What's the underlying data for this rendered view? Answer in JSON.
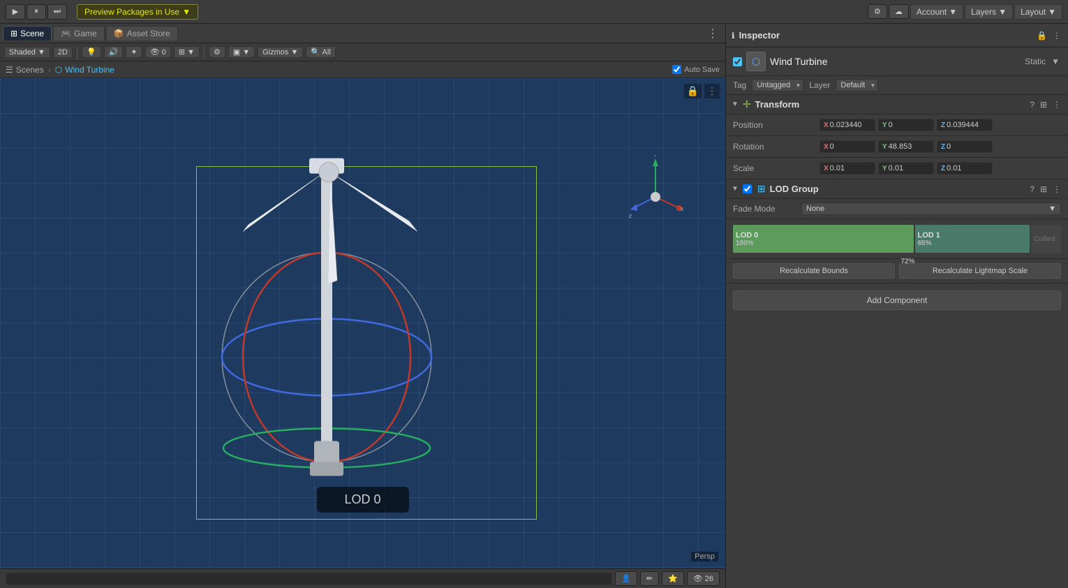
{
  "topbar": {
    "preview_btn": "Preview Packages in Use",
    "account_label": "Account",
    "layers_label": "Layers",
    "layout_label": "Layout"
  },
  "scene_tabs": [
    {
      "id": "scene",
      "label": "Scene",
      "icon": "⊞",
      "active": true
    },
    {
      "id": "game",
      "label": "Game",
      "icon": "🎮",
      "active": false
    },
    {
      "id": "asset_store",
      "label": "Asset Store",
      "icon": "📦",
      "active": false
    }
  ],
  "scene_toolbar": {
    "shading": "Shaded",
    "mode_2d": "2D",
    "gizmos": "Gizmos",
    "search_placeholder": "All"
  },
  "breadcrumb": {
    "scenes": "Scenes",
    "active": "Wind Turbine"
  },
  "autosave": "Auto Save",
  "viewport": {
    "lod_label": "LOD 0",
    "persp": "Persp"
  },
  "inspector": {
    "title": "Inspector",
    "object_name": "Wind Turbine",
    "static_label": "Static",
    "tag_label": "Tag",
    "tag_value": "Untagged",
    "layer_label": "Layer",
    "layer_value": "Default",
    "transform": {
      "title": "Transform",
      "position_label": "Position",
      "px": "0.023440",
      "py": "0",
      "pz": "0.039444",
      "rotation_label": "Rotation",
      "rx": "0",
      "ry": "48.853",
      "rz": "0",
      "scale_label": "Scale",
      "sx": "0.01",
      "sy": "0.01",
      "sz": "0.01"
    },
    "lod_group": {
      "title": "LOD Group",
      "fade_mode_label": "Fade Mode",
      "fade_mode_value": "None",
      "lod0_label": "LOD 0",
      "lod0_pct": "100%",
      "lod1_label": "LOD 1",
      "lod1_pct": "65%",
      "marker_pct": "72%",
      "recalc_bounds": "Recalculate Bounds",
      "recalc_lightmap": "Recalculate Lightmap Scale"
    },
    "add_component": "Add Component"
  },
  "bottom_bar": {
    "search_placeholder": ""
  }
}
